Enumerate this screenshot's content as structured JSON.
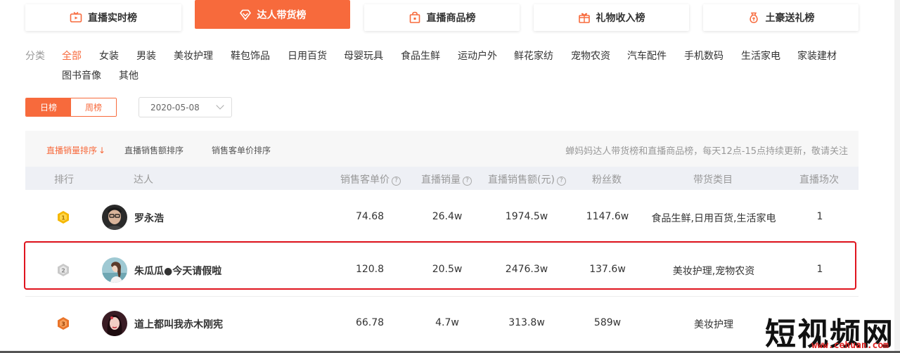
{
  "tabs": [
    {
      "label": "直播实时榜",
      "icon": "live-tv-icon"
    },
    {
      "label": "达人带货榜",
      "icon": "diamond-icon"
    },
    {
      "label": "直播商品榜",
      "icon": "shopping-bag-icon"
    },
    {
      "label": "礼物收入榜",
      "icon": "gift-icon"
    },
    {
      "label": "土豪送礼榜",
      "icon": "money-bag-icon"
    }
  ],
  "colors": {
    "accent": "#f76a3c",
    "highlight_border": "#e0141e",
    "header_bg": "#eef0f5"
  },
  "categories": {
    "label": "分类",
    "items": [
      "全部",
      "女装",
      "男装",
      "美妆护理",
      "鞋包饰品",
      "日用百货",
      "母婴玩具",
      "食品生鲜",
      "运动户外",
      "鲜花家纺",
      "宠物农资",
      "汽车配件",
      "手机数码",
      "生活家电",
      "家装建材",
      "图书音像",
      "其他"
    ],
    "selected": "全部"
  },
  "period": {
    "daily": "日榜",
    "weekly": "周榜",
    "selected": "日榜"
  },
  "date": {
    "value": "2020-05-08"
  },
  "sort": {
    "options": [
      "直播销量排序",
      "直播销售额排序",
      "销售客单价排序"
    ],
    "active_arrow": "↓",
    "note": "蝉妈妈达人带货榜和直播商品榜，每天12点-15点持续更新，敬请关注"
  },
  "table": {
    "headers": [
      "排行",
      "达人",
      "销售客单价",
      "直播销量",
      "直播销售额(元)",
      "粉丝数",
      "带货类目",
      "直播场次"
    ],
    "help_mark": "?",
    "rows": [
      {
        "rank": "1",
        "rank_icon": "gold-medal-icon",
        "name": "罗永浩",
        "unit_price": "74.68",
        "sales_volume": "26.4w",
        "sales_amount": "1974.5w",
        "fans": "1147.6w",
        "categories": "食品生鲜,日用百货,生活家电",
        "sessions": "1"
      },
      {
        "rank": "2",
        "rank_icon": "silver-medal-icon",
        "name": "朱瓜瓜●今天请假啦",
        "unit_price": "120.8",
        "sales_volume": "20.5w",
        "sales_amount": "2476.3w",
        "fans": "137.6w",
        "categories": "美妆护理,宠物农资",
        "sessions": "1"
      },
      {
        "rank": "3",
        "rank_icon": "bronze-medal-icon",
        "name": "道上都叫我赤木刚宪",
        "unit_price": "66.78",
        "sales_volume": "4.7w",
        "sales_amount": "313.8w",
        "fans": "589w",
        "categories": "美妆护理",
        "sessions": ""
      }
    ]
  },
  "watermark": {
    "main": "短视频网",
    "sub": "www.cehuan.com"
  }
}
